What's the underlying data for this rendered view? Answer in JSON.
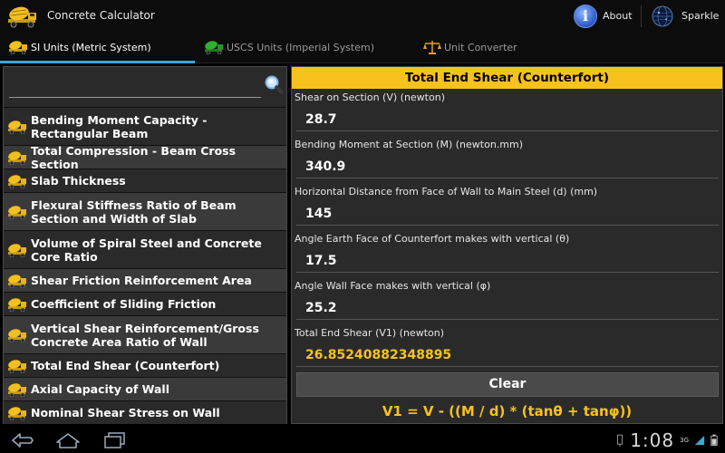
{
  "app": {
    "title": "Concrete Calculator",
    "about_label": "About",
    "sparkle_label": "Sparkle",
    "about_icon_glyph": "i"
  },
  "tabs": [
    {
      "label": "SI Units (Metric System)",
      "selected": true,
      "icon": "truck-icon"
    },
    {
      "label": "USCS Units (Imperial System)",
      "selected": false,
      "icon": "truck-icon"
    },
    {
      "label": "Unit Converter",
      "selected": false,
      "icon": "scale-icon"
    }
  ],
  "search": {
    "value": "",
    "placeholder": ""
  },
  "list_items": [
    "Bending Moment Capacity - Rectangular Beam",
    "Total Compression - Beam Cross Section",
    "Slab Thickness",
    "Flexural Stiffness Ratio of Beam Section and Width of Slab",
    "Volume of Spiral Steel and Concrete Core Ratio",
    "Shear Friction Reinforcement Area",
    "Coefficient of Sliding Friction",
    "Vertical Shear Reinforcement/Gross Concrete Area Ratio of Wall",
    "Total End Shear (Counterfort)",
    "Axial Capacity of Wall",
    "Nominal Shear Stress on Wall"
  ],
  "calculator": {
    "title": "Total End Shear (Counterfort)",
    "fields": [
      {
        "label": "Shear on Section (V) (newton)",
        "value": "28.7"
      },
      {
        "label": "Bending Moment at Section (M) (newton.mm)",
        "value": "340.9"
      },
      {
        "label": "Horizontal Distance from Face of Wall to Main Steel (d) (mm)",
        "value": "145"
      },
      {
        "label": "Angle Earth Face of Counterfort makes with vertical (θ)",
        "value": "17.5"
      },
      {
        "label": "Angle Wall Face makes with vertical (φ)",
        "value": "25.2"
      }
    ],
    "result": {
      "label": "Total End Shear (V1) (newton)",
      "value": "26.85240882348895"
    },
    "clear_label": "Clear",
    "formula": "V1 = V - ((M / d) * (tanθ + tanφ))"
  },
  "status": {
    "clock": "1:08",
    "signal": "3G"
  },
  "colors": {
    "accent": "#f7c21d",
    "tab_indicator": "#39a9d6",
    "panel_bg": "#2a2a2a"
  }
}
